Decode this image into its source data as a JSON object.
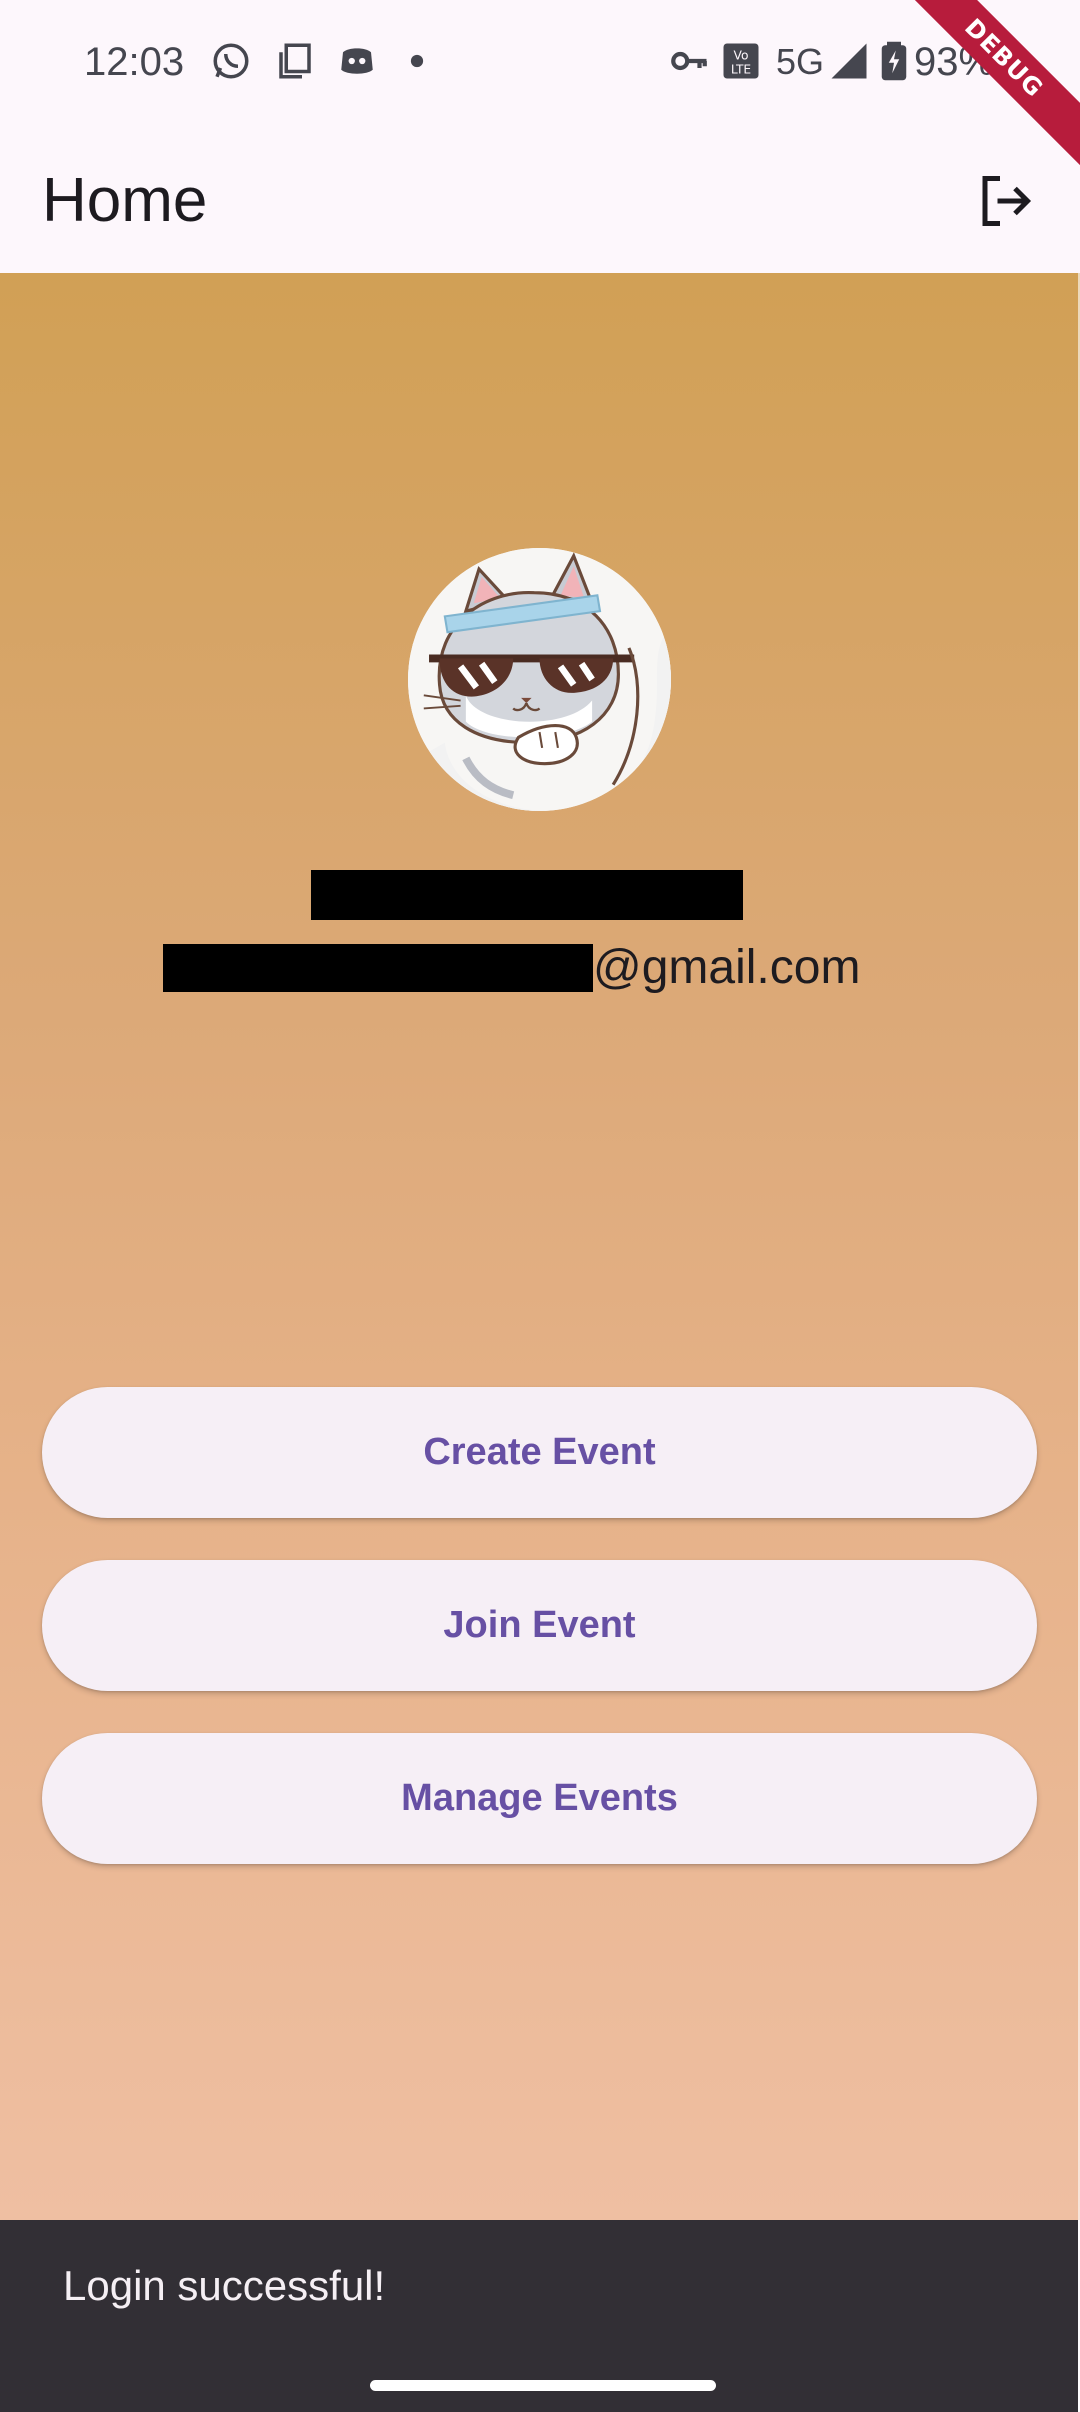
{
  "status_bar": {
    "time": "12:03",
    "network": "5G",
    "battery": "93%",
    "icons": [
      "whatsapp-icon",
      "copy-icon",
      "discord-icon",
      "notification-dot-icon",
      "vpn-key-icon",
      "volte-icon",
      "signal-icon",
      "battery-charging-icon"
    ]
  },
  "debug_banner": "DEBUG",
  "app_bar": {
    "title": "Home",
    "logout_icon": "logout-icon"
  },
  "profile": {
    "avatar_icon": "cat-with-sunglasses-avatar",
    "email_suffix": "@gmail.com"
  },
  "actions": {
    "create_event": "Create Event",
    "join_event": "Join Event",
    "manage_events": "Manage Events"
  },
  "snackbar": {
    "message": "Login successful!"
  },
  "colors": {
    "gradient_top": "#d1a055",
    "gradient_bottom": "#efbfa2",
    "button_text": "#6750a4",
    "snackbar_bg": "#322f35"
  }
}
